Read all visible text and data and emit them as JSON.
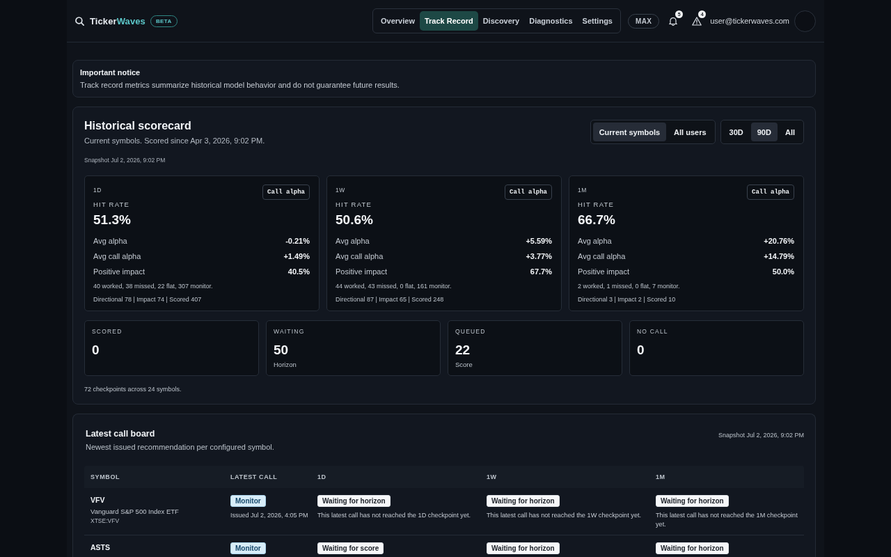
{
  "header": {
    "brand": [
      "Ticker",
      "Waves"
    ],
    "badge": "BETA",
    "nav": [
      {
        "label": "Overview",
        "selected": false
      },
      {
        "label": "Track Record",
        "selected": true
      },
      {
        "label": "Discovery",
        "selected": false
      },
      {
        "label": "Diagnostics",
        "selected": false
      },
      {
        "label": "Settings",
        "selected": false
      }
    ],
    "plan": "MAX",
    "notifications": "5",
    "alerts": "4",
    "user_email": "user@tickerwaves.com"
  },
  "notice": {
    "title": "Important notice",
    "text": "Track record metrics summarize historical model behavior and do not guarantee future results."
  },
  "scorecard": {
    "title": "Historical scorecard",
    "subtitle": "Current symbols. Scored since Apr 3, 2026, 9:02 PM.",
    "snapshot": "Snapshot Jul 2, 2026, 9:02 PM",
    "scope_filter": [
      {
        "label": "Current symbols",
        "selected": true
      },
      {
        "label": "All users",
        "selected": false
      }
    ],
    "range_filter": [
      {
        "label": "30D",
        "selected": false
      },
      {
        "label": "90D",
        "selected": true
      },
      {
        "label": "All",
        "selected": false
      }
    ],
    "horizons": [
      {
        "horizon": "1D",
        "mode_button": "Call alpha",
        "metric_label": "HIT RATE",
        "hit_rate": "51.3%",
        "metrics": [
          {
            "label": "Avg alpha",
            "value": "-0.21%"
          },
          {
            "label": "Avg call alpha",
            "value": "+1.49%"
          },
          {
            "label": "Positive impact",
            "value": "40.5%"
          }
        ],
        "outcomes": "40 worked, 38 missed, 22 flat, 307 monitor.",
        "counts": "Directional 78 | Impact 74 | Scored 407"
      },
      {
        "horizon": "1W",
        "mode_button": "Call alpha",
        "metric_label": "HIT RATE",
        "hit_rate": "50.6%",
        "metrics": [
          {
            "label": "Avg alpha",
            "value": "+5.59%"
          },
          {
            "label": "Avg call alpha",
            "value": "+3.77%"
          },
          {
            "label": "Positive impact",
            "value": "67.7%"
          }
        ],
        "outcomes": "44 worked, 43 missed, 0 flat, 161 monitor.",
        "counts": "Directional 87 | Impact 65 | Scored 248"
      },
      {
        "horizon": "1M",
        "mode_button": "Call alpha",
        "metric_label": "HIT RATE",
        "hit_rate": "66.7%",
        "metrics": [
          {
            "label": "Avg alpha",
            "value": "+20.76%"
          },
          {
            "label": "Avg call alpha",
            "value": "+14.79%"
          },
          {
            "label": "Positive impact",
            "value": "50.0%"
          }
        ],
        "outcomes": "2 worked, 1 missed, 0 flat, 7 monitor.",
        "counts": "Directional 3 | Impact 2 | Scored 10"
      }
    ],
    "status_counts": [
      {
        "label": "SCORED",
        "value": "0"
      },
      {
        "label": "WAITING",
        "value": "50",
        "note": "Horizon"
      },
      {
        "label": "QUEUED",
        "value": "22",
        "note": "Score"
      },
      {
        "label": "NO CALL",
        "value": "0"
      }
    ],
    "footnote": "72 checkpoints across 24 symbols."
  },
  "call_board": {
    "title": "Latest call board",
    "subtitle": "Newest issued recommendation per configured symbol.",
    "snapshot": "Snapshot Jul 2, 2026, 9:02 PM",
    "columns": [
      "SYMBOL",
      "LATEST CALL",
      "1D",
      "1W",
      "1M"
    ],
    "rows": [
      {
        "symbol": "VFV",
        "name": "Vanguard S&P 500 Index ETF",
        "listing": "XTSE:VFV",
        "call": "Monitor",
        "issued": "Issued Jul 2, 2026, 4:05 PM",
        "checkpoints": [
          {
            "status": "Waiting for horizon",
            "note": "This latest call has not reached the 1D checkpoint yet."
          },
          {
            "status": "Waiting for horizon",
            "note": "This latest call has not reached the 1W checkpoint yet."
          },
          {
            "status": "Waiting for horizon",
            "note": "This latest call has not reached the 1M checkpoint yet."
          }
        ]
      },
      {
        "symbol": "ASTS",
        "call": "Monitor",
        "checkpoints": [
          {
            "status": "Waiting for score"
          },
          {
            "status": "Waiting for horizon"
          },
          {
            "status": "Waiting for horizon"
          }
        ]
      }
    ]
  }
}
